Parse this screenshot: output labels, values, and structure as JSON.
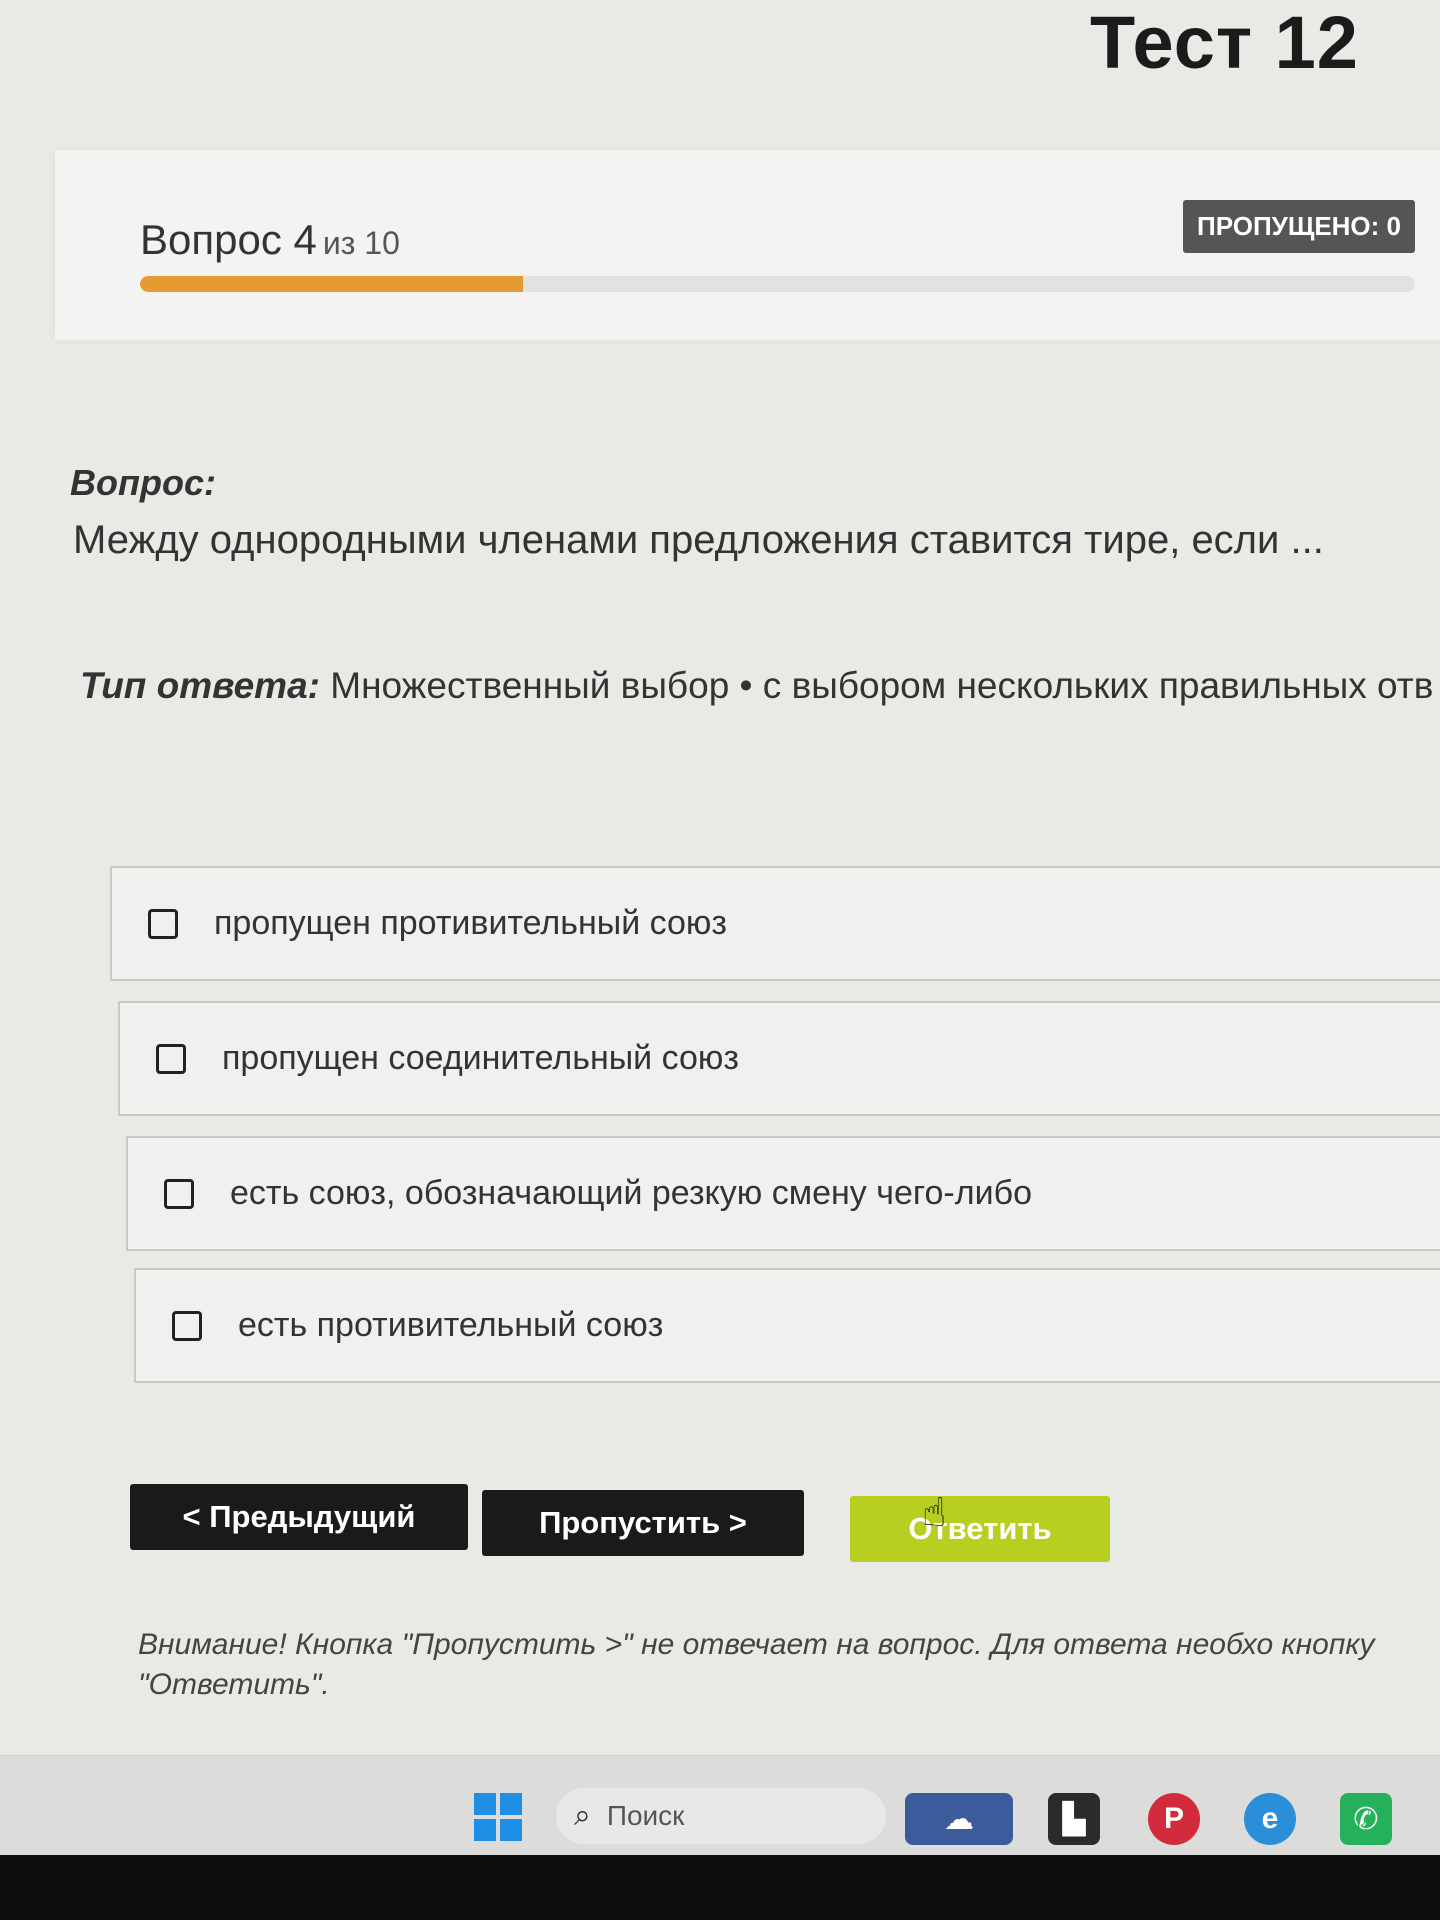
{
  "test": {
    "title": "Тест 12"
  },
  "progress": {
    "question_label": "Вопрос 4",
    "of_label": "из 10",
    "current": 4,
    "total": 10,
    "fill_fraction": 0.3,
    "skipped_badge": "ПРОПУЩЕНО: 0"
  },
  "question": {
    "label": "Вопрос:",
    "text": "Между однородными членами предложения ставится тире, если ...",
    "type_label": "Тип ответа:",
    "type_value": "Множественный выбор • с выбором нескольких правильных отв"
  },
  "options": [
    {
      "text": "пропущен противительный союз",
      "checked": false
    },
    {
      "text": "пропущен соединительный союз",
      "checked": false
    },
    {
      "text": "есть союз, обозначающий резкую смену чего-либо",
      "checked": false
    },
    {
      "text": "есть противительный союз",
      "checked": false
    }
  ],
  "buttons": {
    "prev": "< Предыдущий",
    "skip": "Пропустить >",
    "answer": "Ответить"
  },
  "note": "Внимание! Кнопка \"Пропустить >\" не отвечает на вопрос. Для ответа необхо кнопку \"Ответить\".",
  "taskbar": {
    "search_placeholder": "Поиск",
    "icons": [
      "windows-start-icon",
      "search-icon",
      "widget-icon",
      "file-explorer-icon",
      "pinterest-icon",
      "edge-icon",
      "whatsapp-icon"
    ]
  },
  "colors": {
    "progress_fill": "#e59a32",
    "answer_button": "#b8cf21",
    "dark_button": "#1a1a1a",
    "badge": "#555555"
  }
}
